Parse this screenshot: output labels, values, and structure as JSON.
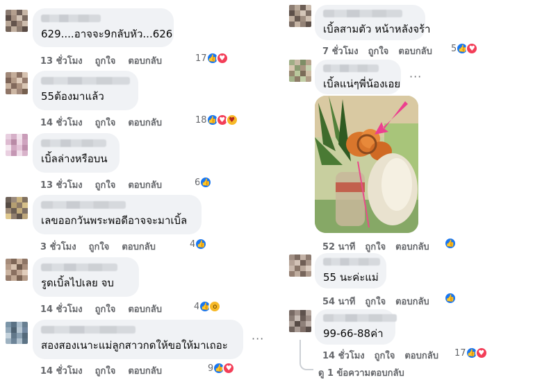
{
  "colors": {
    "bubble": "#f0f2f5",
    "meta": "#65676b",
    "like": "#1877f2",
    "love": "#f33e58"
  },
  "left_comments": [
    {
      "text": "629....อาจจะ9กลับหัว...626",
      "time": "13 ชั่วโมง",
      "like": "ถูกใจ",
      "reply": "ตอบกลับ",
      "count": "17",
      "reactions": [
        "like-icon",
        "love-icon"
      ]
    },
    {
      "text": "55ต้องมาแล้ว",
      "time": "14 ชั่วโมง",
      "like": "ถูกใจ",
      "reply": "ตอบกลับ",
      "count": "18",
      "reactions": [
        "like-icon",
        "love-icon",
        "care-icon"
      ]
    },
    {
      "text": "เบิ้ลล่างหรือบน",
      "time": "13 ชั่วโมง",
      "like": "ถูกใจ",
      "reply": "ตอบกลับ",
      "count": "6",
      "reactions": [
        "like-icon"
      ]
    },
    {
      "text": "เลขออกวันพระพอดีอาจจะมาเบิ้ล",
      "time": "3 ชั่วโมง",
      "like": "ถูกใจ",
      "reply": "ตอบกลับ",
      "count": "4",
      "reactions": [
        "like-icon"
      ]
    },
    {
      "text": "รูดเบิ้ลไปเลย จบ",
      "time": "14 ชั่วโมง",
      "like": "ถูกใจ",
      "reply": "ตอบกลับ",
      "count": "4",
      "reactions": [
        "like-icon",
        "wow-icon"
      ]
    },
    {
      "text": "สองสองเนาะแม่ลูกสาวกดให้ขอให้มาเถอะ",
      "time": "14 ชั่วโมง",
      "like": "ถูกใจ",
      "reply": "ตอบกลับ",
      "count": "9",
      "reactions": [
        "like-icon",
        "love-icon"
      ]
    }
  ],
  "right_comments": [
    {
      "text": "เบิ้ลสามตัว หน้าหลังจร้า",
      "time": "7 ชั่วโมง",
      "like": "ถูกใจ",
      "reply": "ตอบกลับ",
      "count": "5",
      "reactions": [
        "like-icon",
        "love-icon"
      ]
    },
    {
      "text": "เบิ้ลแน่ๆพี่น้องเอย",
      "time": "52 นาที",
      "like": "ถูกใจ",
      "reply": "ตอบกลับ",
      "count": "",
      "reactions": [
        "like-icon"
      ]
    },
    {
      "text": "55 นะค่ะแม่",
      "time": "54 นาที",
      "like": "ถูกใจ",
      "reply": "ตอบกลับ",
      "count": "",
      "reactions": [
        "like-icon"
      ]
    },
    {
      "text": "99-66-88ค่า",
      "time": "14 ชั่วโมง",
      "like": "ถูกใจ",
      "reply": "ตอบกลับ",
      "count": "17",
      "reactions": [
        "like-icon",
        "love-icon"
      ]
    }
  ],
  "more_label": "···",
  "view_replies": "ดู 1 ข้อความตอบกลับ"
}
